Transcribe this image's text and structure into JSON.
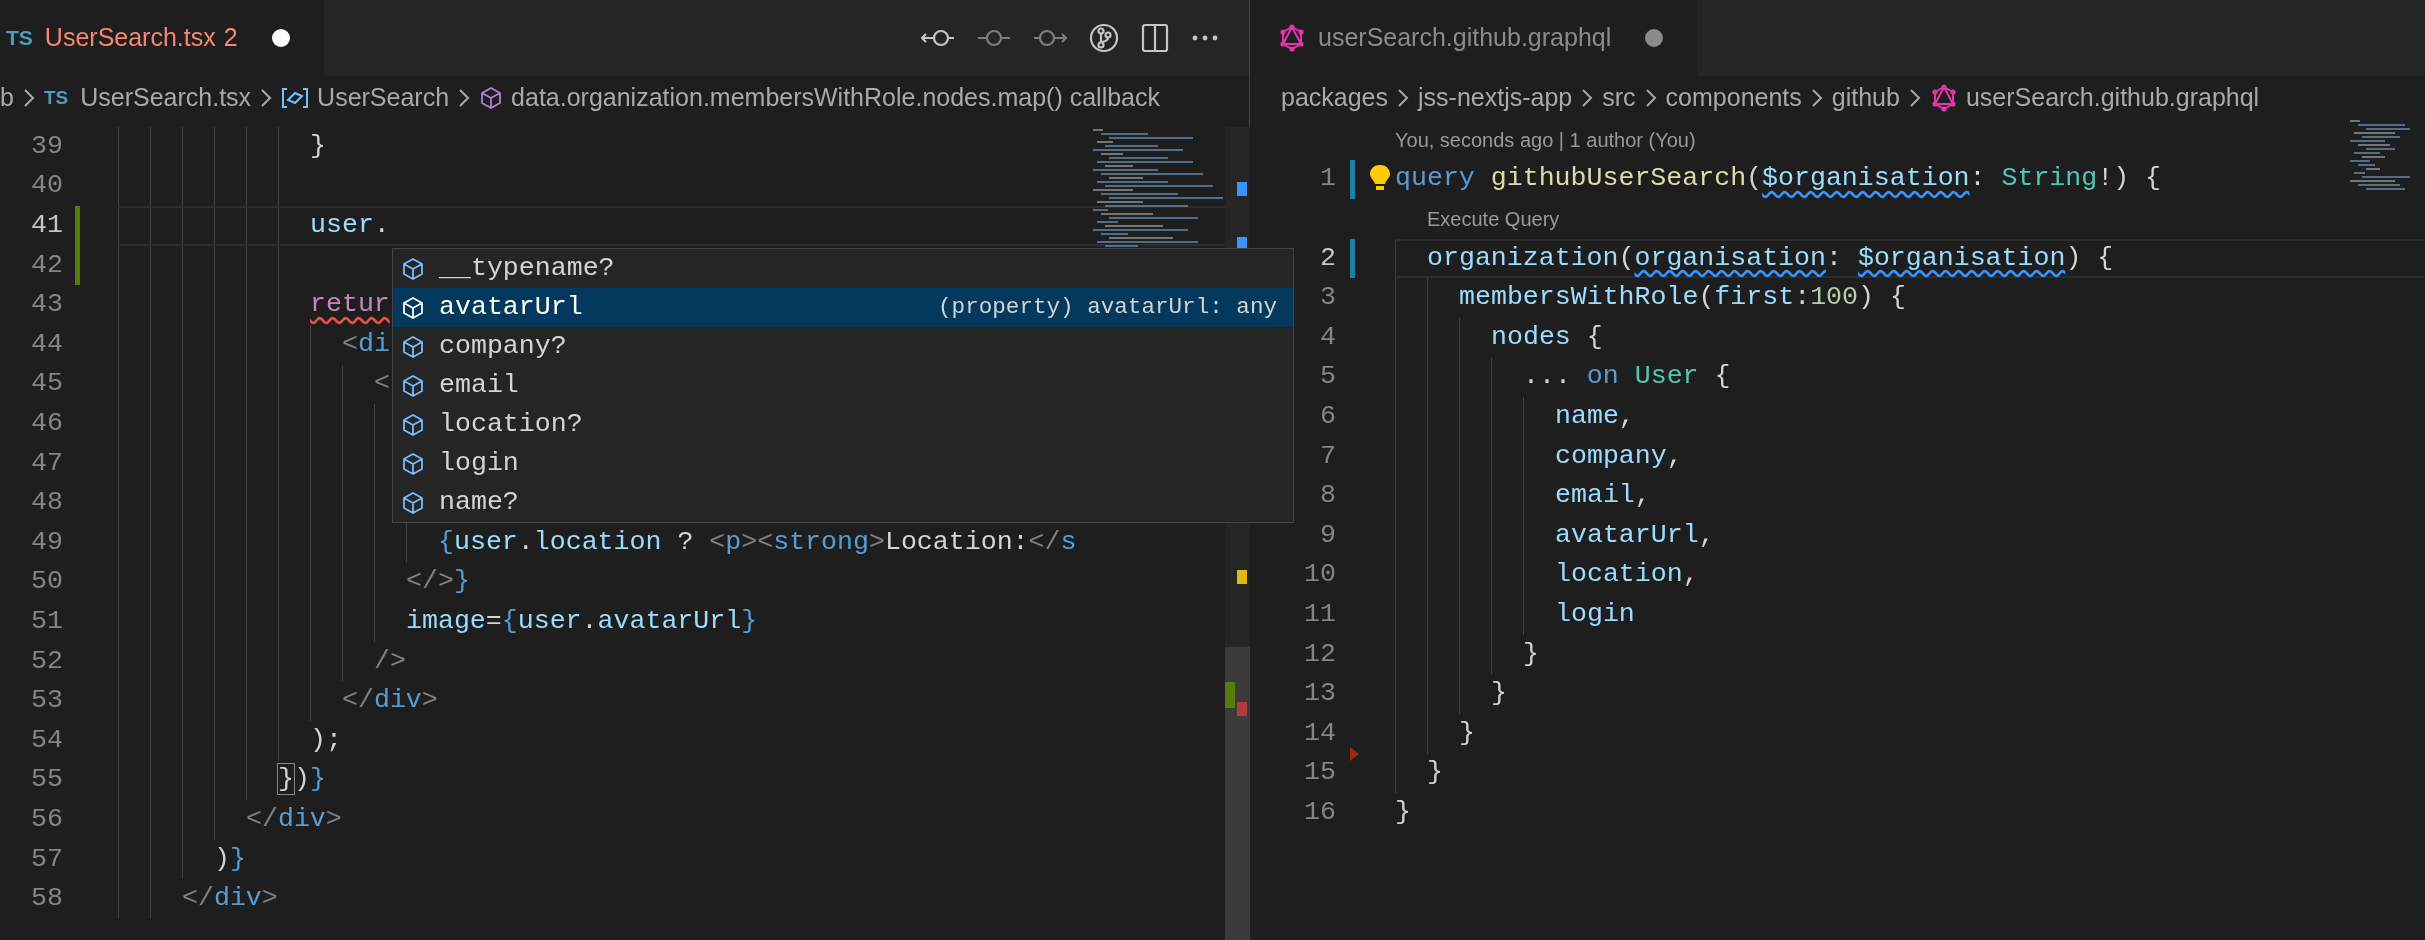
{
  "left_editor": {
    "focused": true,
    "tab": {
      "icon_text": "TS",
      "label": "UserSearch.tsx",
      "problems": "2",
      "modified": true
    },
    "breadcrumbs": [
      {
        "text": "b",
        "kind": "folder"
      },
      {
        "text": "UserSearch.tsx",
        "kind": "file",
        "icon_text": "TS"
      },
      {
        "text": "UserSearch",
        "kind": "variable"
      },
      {
        "text": "data.organization.membersWithRole.nodes.map() callback",
        "kind": "method"
      }
    ],
    "lines": [
      {
        "number": "39",
        "tokens": [
          {
            "text": "            }",
            "kind": "text"
          }
        ]
      },
      {
        "number": "40"
      },
      {
        "number": "41",
        "current": true,
        "added": true,
        "tokens": [
          {
            "text": "            user",
            "kind": "variable"
          },
          {
            "text": ".",
            "kind": "text"
          }
        ]
      },
      {
        "number": "42",
        "added": true
      },
      {
        "number": "43",
        "tokens": [
          {
            "text": "            retur",
            "kind": "keyword",
            "error": true
          }
        ]
      },
      {
        "number": "44",
        "tokens": [
          {
            "text": "              <",
            "kind": "punct"
          },
          {
            "text": "di",
            "kind": "tag"
          }
        ]
      },
      {
        "number": "45",
        "tokens": [
          {
            "text": "                <",
            "kind": "punct"
          }
        ]
      },
      {
        "number": "46"
      },
      {
        "number": "47"
      },
      {
        "number": "48"
      },
      {
        "number": "49",
        "tokens": [
          {
            "text": "                    {",
            "kind": "brace"
          },
          {
            "text": "user",
            "kind": "variable"
          },
          {
            "text": ".",
            "kind": "text"
          },
          {
            "text": "location",
            "kind": "variable"
          },
          {
            "text": " ? ",
            "kind": "text"
          },
          {
            "text": "<",
            "kind": "punct"
          },
          {
            "text": "p",
            "kind": "tag"
          },
          {
            "text": "><",
            "kind": "punct"
          },
          {
            "text": "strong",
            "kind": "tag"
          },
          {
            "text": ">",
            "kind": "punct"
          },
          {
            "text": "Location:",
            "kind": "text"
          },
          {
            "text": "</",
            "kind": "punct"
          },
          {
            "text": "s",
            "kind": "tag"
          }
        ]
      },
      {
        "number": "50",
        "tokens": [
          {
            "text": "                  </>",
            "kind": "punct"
          },
          {
            "text": "}",
            "kind": "brace"
          }
        ]
      },
      {
        "number": "51",
        "tokens": [
          {
            "text": "                  image",
            "kind": "variable"
          },
          {
            "text": "=",
            "kind": "text"
          },
          {
            "text": "{",
            "kind": "brace"
          },
          {
            "text": "user",
            "kind": "variable"
          },
          {
            "text": ".",
            "kind": "text"
          },
          {
            "text": "avatarUrl",
            "kind": "variable"
          },
          {
            "text": "}",
            "kind": "brace"
          }
        ]
      },
      {
        "number": "52",
        "tokens": [
          {
            "text": "                />",
            "kind": "punct"
          }
        ]
      },
      {
        "number": "53",
        "tokens": [
          {
            "text": "              </",
            "kind": "punct"
          },
          {
            "text": "div",
            "kind": "tag"
          },
          {
            "text": ">",
            "kind": "punct"
          }
        ]
      },
      {
        "number": "54",
        "tokens": [
          {
            "text": "            );",
            "kind": "text"
          }
        ]
      },
      {
        "number": "55",
        "tokens": [
          {
            "text": "          }",
            "kind": "text",
            "matched": true
          },
          {
            "text": ")",
            "kind": "text"
          },
          {
            "text": "}",
            "kind": "brace"
          }
        ]
      },
      {
        "number": "56",
        "tokens": [
          {
            "text": "        </",
            "kind": "punct"
          },
          {
            "text": "div",
            "kind": "tag"
          },
          {
            "text": ">",
            "kind": "punct"
          }
        ]
      },
      {
        "number": "57",
        "tokens": [
          {
            "text": "      )",
            "kind": "text"
          },
          {
            "text": "}",
            "kind": "brace"
          }
        ]
      },
      {
        "number": "58",
        "tokens": [
          {
            "text": "    </",
            "kind": "punct"
          },
          {
            "text": "div",
            "kind": "tag"
          },
          {
            "text": ">",
            "kind": "punct"
          }
        ]
      }
    ],
    "suggestions": [
      {
        "label": "__typename?",
        "selected": false
      },
      {
        "label": "avatarUrl",
        "selected": true,
        "detail": "(property) avatarUrl: any"
      },
      {
        "label": "company?",
        "selected": false
      },
      {
        "label": "email",
        "selected": false
      },
      {
        "label": "location?",
        "selected": false
      },
      {
        "label": "login",
        "selected": false
      },
      {
        "label": "name?",
        "selected": false
      }
    ]
  },
  "right_editor": {
    "focused": false,
    "tab": {
      "label": "userSearch.github.graphql",
      "modified": true
    },
    "breadcrumbs": [
      {
        "text": "packages",
        "kind": "folder"
      },
      {
        "text": "jss-nextjs-app",
        "kind": "folder"
      },
      {
        "text": "src",
        "kind": "folder"
      },
      {
        "text": "components",
        "kind": "folder"
      },
      {
        "text": "github",
        "kind": "folder"
      },
      {
        "text": "userSearch.github.graphql",
        "kind": "graphql"
      }
    ],
    "lines": [
      {
        "number": "1",
        "lens": "You, seconds ago | 1 author (You)",
        "lightbulb": true,
        "modified": true,
        "tokens": [
          {
            "text": "query",
            "kind": "storage"
          },
          {
            "text": " githubUserSearch",
            "kind": "function"
          },
          {
            "text": "(",
            "kind": "text"
          },
          {
            "text": "$organisation",
            "kind": "variable",
            "misspelled": true
          },
          {
            "text": ": ",
            "kind": "text"
          },
          {
            "text": "String",
            "kind": "type"
          },
          {
            "text": "!) {",
            "kind": "text"
          }
        ]
      },
      {
        "number": "2",
        "lens": "Execute Query",
        "current": true,
        "modified": true,
        "tokens": [
          {
            "text": "  organization",
            "kind": "variable"
          },
          {
            "text": "(",
            "kind": "text"
          },
          {
            "text": "organisation",
            "kind": "variable",
            "misspelled": true
          },
          {
            "text": ": ",
            "kind": "text"
          },
          {
            "text": "$organisation",
            "kind": "variable",
            "misspelled": true
          },
          {
            "text": ") {",
            "kind": "text"
          }
        ]
      },
      {
        "number": "3",
        "tokens": [
          {
            "text": "    membersWithRole",
            "kind": "variable"
          },
          {
            "text": "(",
            "kind": "text"
          },
          {
            "text": "first",
            "kind": "variable"
          },
          {
            "text": ":",
            "kind": "text"
          },
          {
            "text": "100",
            "kind": "number"
          },
          {
            "text": ") {",
            "kind": "text"
          }
        ]
      },
      {
        "number": "4",
        "tokens": [
          {
            "text": "      nodes",
            "kind": "variable"
          },
          {
            "text": " {",
            "kind": "text"
          }
        ]
      },
      {
        "number": "5",
        "tokens": [
          {
            "text": "        ... ",
            "kind": "text"
          },
          {
            "text": "on",
            "kind": "storage"
          },
          {
            "text": " User",
            "kind": "type"
          },
          {
            "text": " {",
            "kind": "text"
          }
        ]
      },
      {
        "number": "6",
        "tokens": [
          {
            "text": "          name",
            "kind": "variable"
          },
          {
            "text": ",",
            "kind": "text"
          }
        ]
      },
      {
        "number": "7",
        "tokens": [
          {
            "text": "          company",
            "kind": "variable"
          },
          {
            "text": ",",
            "kind": "text"
          }
        ]
      },
      {
        "number": "8",
        "tokens": [
          {
            "text": "          email",
            "kind": "variable"
          },
          {
            "text": ",",
            "kind": "text"
          }
        ]
      },
      {
        "number": "9",
        "tokens": [
          {
            "text": "          avatarUrl",
            "kind": "variable"
          },
          {
            "text": ",",
            "kind": "text"
          }
        ]
      },
      {
        "number": "10",
        "tokens": [
          {
            "text": "          location",
            "kind": "variable"
          },
          {
            "text": ",",
            "kind": "text"
          }
        ]
      },
      {
        "number": "11",
        "tokens": [
          {
            "text": "          login",
            "kind": "variable"
          }
        ]
      },
      {
        "number": "12",
        "tokens": [
          {
            "text": "        }",
            "kind": "text"
          }
        ]
      },
      {
        "number": "13",
        "tokens": [
          {
            "text": "      }",
            "kind": "text"
          }
        ]
      },
      {
        "number": "14",
        "deleted": true,
        "tokens": [
          {
            "text": "    }",
            "kind": "text"
          }
        ]
      },
      {
        "number": "15",
        "tokens": [
          {
            "text": "  }",
            "kind": "text"
          }
        ]
      },
      {
        "number": "16",
        "tokens": [
          {
            "text": "}",
            "kind": "text"
          }
        ]
      }
    ]
  }
}
